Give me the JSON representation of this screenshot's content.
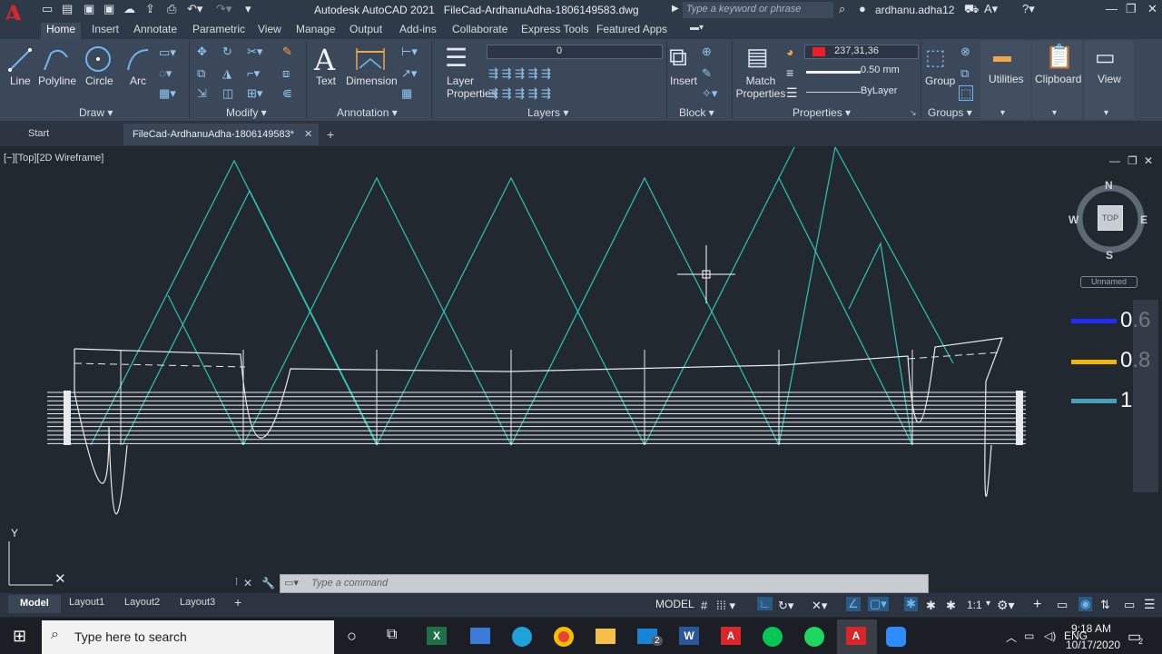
{
  "window": {
    "app_title": "Autodesk AutoCAD 2021",
    "file_title": "FileCad-ArdhanuAdha-1806149583.dwg",
    "search_placeholder": "Type a keyword or phrase",
    "user": "ardhanu.adha12"
  },
  "ribbon_tabs": [
    "Home",
    "Insert",
    "Annotate",
    "Parametric",
    "View",
    "Manage",
    "Output",
    "Add-ins",
    "Collaborate",
    "Express Tools",
    "Featured Apps"
  ],
  "ribbon": {
    "draw": {
      "title": "Draw",
      "tools": [
        "Line",
        "Polyline",
        "Circle",
        "Arc"
      ]
    },
    "modify": {
      "title": "Modify"
    },
    "annotation": {
      "title": "Annotation",
      "text": "Text",
      "dimension": "Dimension"
    },
    "layers": {
      "title": "Layers",
      "layer_properties": "Layer Properties",
      "current_layer": "0"
    },
    "block": {
      "title": "Block",
      "insert": "Insert"
    },
    "properties": {
      "title": "Properties",
      "match": "Match Properties",
      "color_value": "237,31,36",
      "color_hex": "#ed1f24",
      "lineweight": "0.50 mm",
      "linetype": "ByLayer"
    },
    "groups": {
      "title": "Groups",
      "group": "Group"
    },
    "utilities": "Utilities",
    "clipboard": "Clipboard",
    "view": "View"
  },
  "file_tabs": {
    "start": "Start",
    "active": "FileCad-ArdhanuAdha-1806149583*"
  },
  "viewport": {
    "label": "[−][Top][2D Wireframe]",
    "viewcube": {
      "n": "N",
      "s": "S",
      "e": "E",
      "w": "W",
      "face": "TOP"
    },
    "ucs_label": "Unnamed",
    "ucs_y": "Y"
  },
  "legend": [
    {
      "value": "0.6",
      "color": "#1f2bff"
    },
    {
      "value": "0.8",
      "color": "#f2b705"
    },
    {
      "value": "1",
      "color": "#4aa0b6"
    }
  ],
  "command": {
    "placeholder": "Type a command"
  },
  "layout_tabs": [
    "Model",
    "Layout1",
    "Layout2",
    "Layout3"
  ],
  "status": {
    "model": "MODEL",
    "scale": "1:1"
  },
  "taskbar": {
    "search_placeholder": "Type here to search",
    "time": "9:18 AM",
    "date": "10/17/2020",
    "mail_badge": "2",
    "notif_badge": "2"
  },
  "colors": {
    "accent": "#2f8fd8",
    "drawing_line": "#2ec4b6",
    "hull_line": "#e8eaed"
  }
}
